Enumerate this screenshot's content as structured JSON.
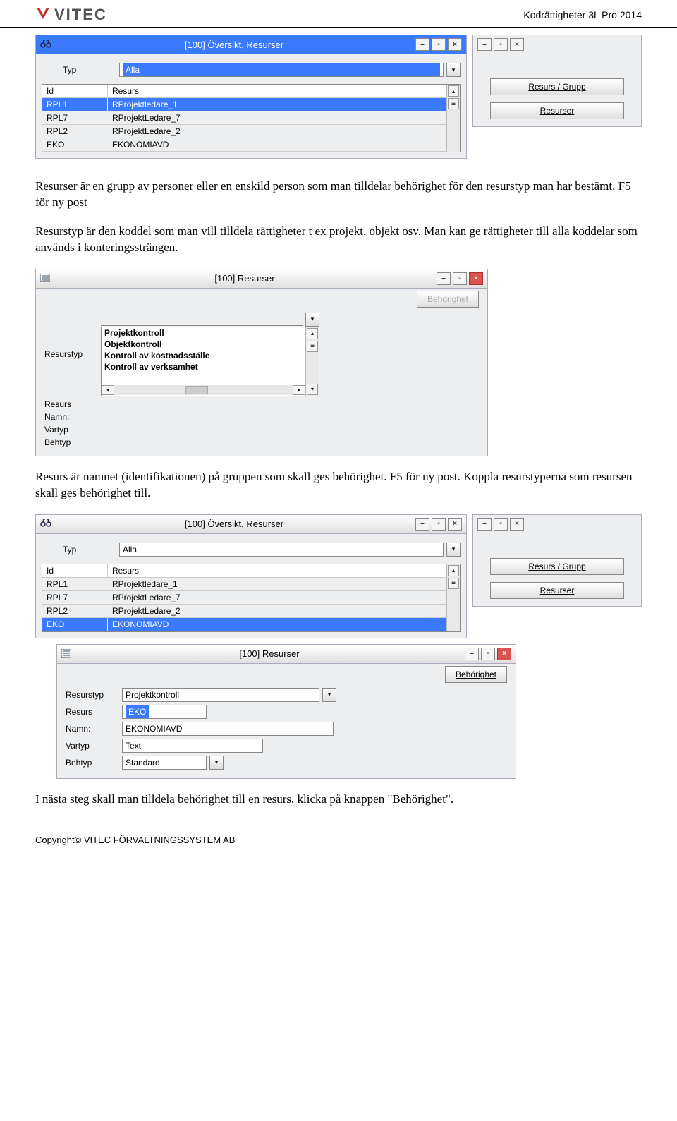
{
  "header": {
    "logo_text": "VITEC",
    "right": "Kodrättigheter 3L Pro 2014"
  },
  "window1": {
    "title": "[100] Översikt, Resurser",
    "typ_label": "Typ",
    "typ_value": "Alla",
    "table": {
      "headers": [
        "Id",
        "Resurs"
      ],
      "rows": [
        {
          "id": "RPL1",
          "resurs": "RProjektledare_1",
          "selected": true
        },
        {
          "id": "RPL7",
          "resurs": "RProjektLedare_7",
          "selected": false
        },
        {
          "id": "RPL2",
          "resurs": "RProjektLedare_2",
          "selected": false
        },
        {
          "id": "EKO",
          "resurs": "EKONOMIAVD",
          "selected": false
        }
      ]
    },
    "side_right": {
      "btn1": "Resurs / Grupp",
      "btn2": "Resurser"
    }
  },
  "para1": "Resurser är en grupp av personer eller en enskild person som man tilldelar behörighet för den resurstyp man har bestämt. F5 för ny post",
  "para2": "Resurstyp är den koddel som man vill tilldela rättigheter t ex projekt, objekt osv. Man kan ge rättigheter till alla koddelar som används i konteringssträngen.",
  "window2": {
    "title": "[100] Resurser",
    "btn_behorighet": "Behörighet",
    "labels": {
      "resurstyp": "Resurstyp",
      "resurs": "Resurs",
      "namn": "Namn:",
      "vartyp": "Vartyp",
      "behtyp": "Behtyp"
    },
    "list_items": [
      "Projektkontroll",
      "Objektkontroll",
      "Kontroll av kostnadsställe",
      "Kontroll av verksamhet"
    ]
  },
  "para3": "Resurs är namnet (identifikationen) på gruppen som skall ges behörighet. F5 för ny post. Koppla resurstyperna som resursen skall ges behörighet till.",
  "window3": {
    "title": "[100] Översikt, Resurser",
    "typ_label": "Typ",
    "typ_value": "Alla",
    "table": {
      "headers": [
        "Id",
        "Resurs"
      ],
      "rows": [
        {
          "id": "RPL1",
          "resurs": "RProjektledare_1",
          "selected": false
        },
        {
          "id": "RPL7",
          "resurs": "RProjektLedare_7",
          "selected": false
        },
        {
          "id": "RPL2",
          "resurs": "RProjektLedare_2",
          "selected": false
        },
        {
          "id": "EKO",
          "resurs": "EKONOMIAVD",
          "selected": true
        }
      ]
    },
    "side_right": {
      "btn1": "Resurs / Grupp",
      "btn2": "Resurser"
    }
  },
  "window4": {
    "title": "[100] Resurser",
    "btn_behorighet": "Behörighet",
    "labels": {
      "resurstyp": "Resurstyp",
      "resurs": "Resurs",
      "namn": "Namn:",
      "vartyp": "Vartyp",
      "behtyp": "Behtyp"
    },
    "values": {
      "resurstyp": "Projektkontroll",
      "resurs": "EKO",
      "namn": "EKONOMIAVD",
      "vartyp": "Text",
      "behtyp": "Standard"
    }
  },
  "para4": "I nästa steg skall man tilldela behörighet till en resurs, klicka på knappen \"Behörighet\".",
  "footer": "Copyright© VITEC FÖRVALTNINGSSYSTEM AB"
}
